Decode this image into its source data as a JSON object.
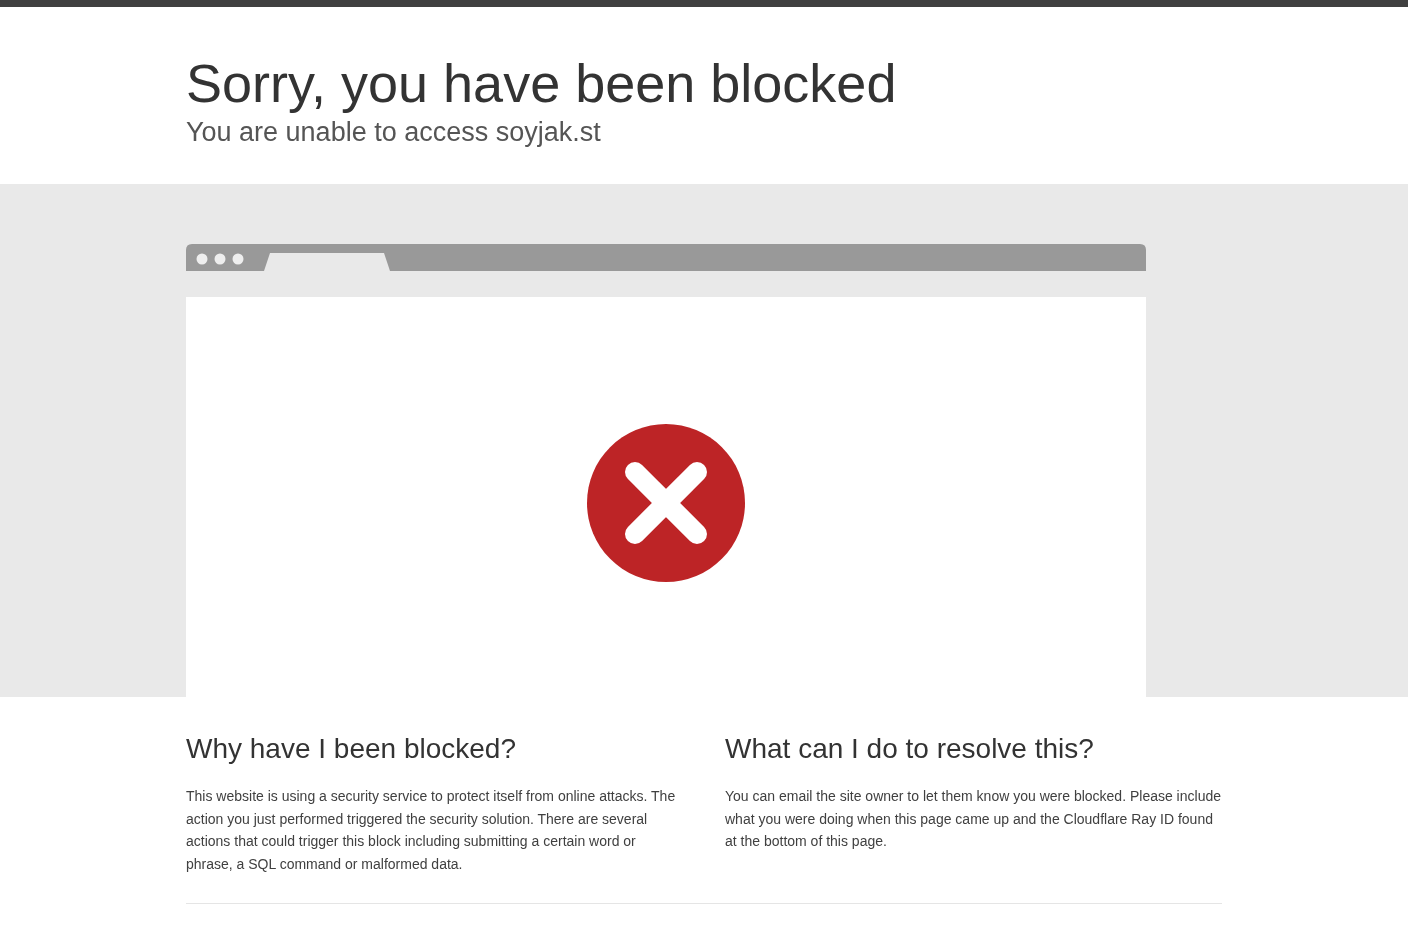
{
  "header": {
    "title": "Sorry, you have been blocked",
    "subtitle": "You are unable to access soyjak.st"
  },
  "sections": [
    {
      "heading": "Why have I been blocked?",
      "text": "This website is using a security service to protect itself from online attacks. The action you just performed triggered the security solution. There are several actions that could trigger this block including submitting a certain word or phrase, a SQL command or malformed data."
    },
    {
      "heading": "What can I do to resolve this?",
      "text": "You can email the site owner to let them know you were blocked. Please include what you were doing when this page came up and the Cloudflare Ray ID found at the bottom of this page."
    }
  ]
}
